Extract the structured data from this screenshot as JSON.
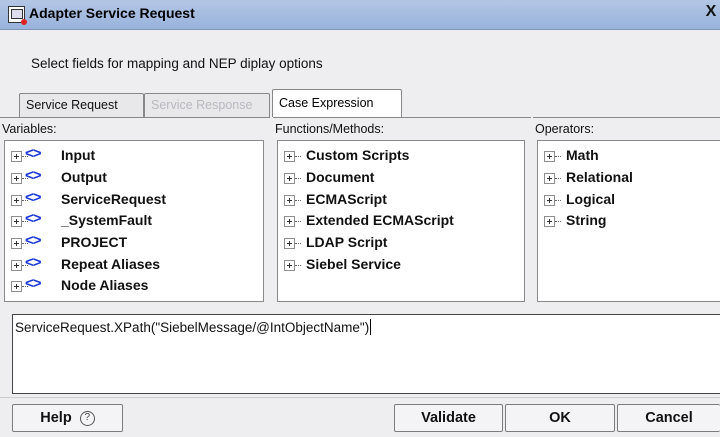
{
  "window": {
    "title": "Adapter Service Request",
    "close_label": "X"
  },
  "instructions": "Select fields for mapping and NEP diplay options",
  "tabs": [
    {
      "label": "Service Request",
      "state": "normal"
    },
    {
      "label": "Service Response",
      "state": "disabled"
    },
    {
      "label": "Case Expression",
      "state": "selected"
    }
  ],
  "variables": {
    "label": "Variables:",
    "icon": "xml-tag-icon",
    "items": [
      "Input",
      "Output",
      "ServiceRequest",
      "_SystemFault",
      "PROJECT",
      "Repeat Aliases",
      "Node Aliases"
    ]
  },
  "functions": {
    "label": "Functions/Methods:",
    "items": [
      "Custom Scripts",
      "Document",
      "ECMAScript",
      "Extended ECMAScript",
      "LDAP Script",
      "Siebel Service"
    ]
  },
  "operators": {
    "label": "Operators:",
    "items": [
      "Math",
      "Relational",
      "Logical",
      "String"
    ]
  },
  "expression": {
    "value": "ServiceRequest.XPath(\"SiebelMessage/@IntObjectName\")"
  },
  "buttons": {
    "help": "Help",
    "validate": "Validate",
    "ok": "OK",
    "cancel": "Cancel"
  },
  "colors": {
    "titlebar": "#a9bfe2",
    "tag_icon": "#1a37d6",
    "disabled_text": "#b8b8c0"
  }
}
